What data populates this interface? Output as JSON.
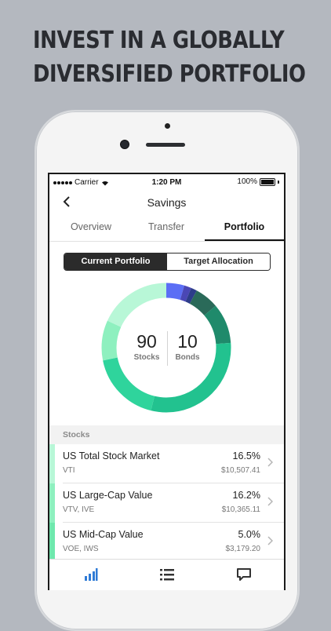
{
  "headline": {
    "line1": "INVEST IN A GLOBALLY",
    "line2": "DIVERSIFIED PORTFOLIO"
  },
  "status_bar": {
    "carrier": "Carrier",
    "time": "1:20 PM",
    "battery": "100%"
  },
  "nav": {
    "title": "Savings"
  },
  "tabs": [
    {
      "label": "Overview"
    },
    {
      "label": "Transfer"
    },
    {
      "label": "Portfolio",
      "selected": true
    }
  ],
  "segment": {
    "current": "Current Portfolio",
    "target": "Target Allocation",
    "selected": "current"
  },
  "allocation": {
    "stocks": {
      "value": "90",
      "label": "Stocks"
    },
    "bonds": {
      "value": "10",
      "label": "Bonds"
    }
  },
  "donut_segments": [
    {
      "color": "#5b6ef5",
      "share": 0.045
    },
    {
      "color": "#4a47b5",
      "share": 0.018
    },
    {
      "color": "#2d3d8a",
      "share": 0.015
    },
    {
      "color": "#2a6a59",
      "share": 0.06
    },
    {
      "color": "#1f8a6b",
      "share": 0.1
    },
    {
      "color": "#22c28f",
      "share": 0.3
    },
    {
      "color": "#2fd49c",
      "share": 0.18
    },
    {
      "color": "#8ef0bf",
      "share": 0.1
    },
    {
      "color": "#b8f7d7",
      "share": 0.182
    }
  ],
  "section": {
    "title": "Stocks"
  },
  "holdings": [
    {
      "name": "US Total Stock Market",
      "tickers": "VTI",
      "pct": "16.5%",
      "amount": "$10,507.41",
      "color": "#b8f7d7"
    },
    {
      "name": "US Large-Cap Value",
      "tickers": "VTV, IVE",
      "pct": "16.2%",
      "amount": "$10,365.11",
      "color": "#8ef0bf"
    },
    {
      "name": "US Mid-Cap Value",
      "tickers": "VOE, IWS",
      "pct": "5.0%",
      "amount": "$3,179.20",
      "color": "#6fe8ad"
    }
  ],
  "tabbar": [
    {
      "icon": "chart-bars-icon",
      "active": true
    },
    {
      "icon": "list-icon"
    },
    {
      "icon": "chat-bubble-icon"
    }
  ],
  "colors": {
    "accent": "#2f7bd6",
    "background": "#b4b8bf"
  }
}
